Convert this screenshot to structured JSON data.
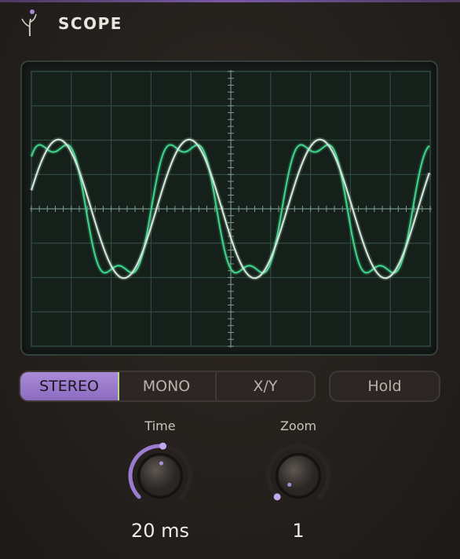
{
  "app": {
    "title": "SCOPE"
  },
  "modes": {
    "items": [
      "STEREO",
      "MONO",
      "X/Y"
    ],
    "selected": "STEREO"
  },
  "hold": {
    "label": "Hold"
  },
  "knobs": {
    "time": {
      "label": "Time",
      "value": "20 ms",
      "level": 0.52
    },
    "zoom": {
      "label": "Zoom",
      "value": "1",
      "level": 0.0
    }
  },
  "colors": {
    "accent": "#9b7bd0",
    "trace_left": "#3ed08a",
    "trace_right": "#cfe6d8",
    "grid": "#2f4a42"
  },
  "icons": {
    "logo": "sprout-icon"
  }
}
